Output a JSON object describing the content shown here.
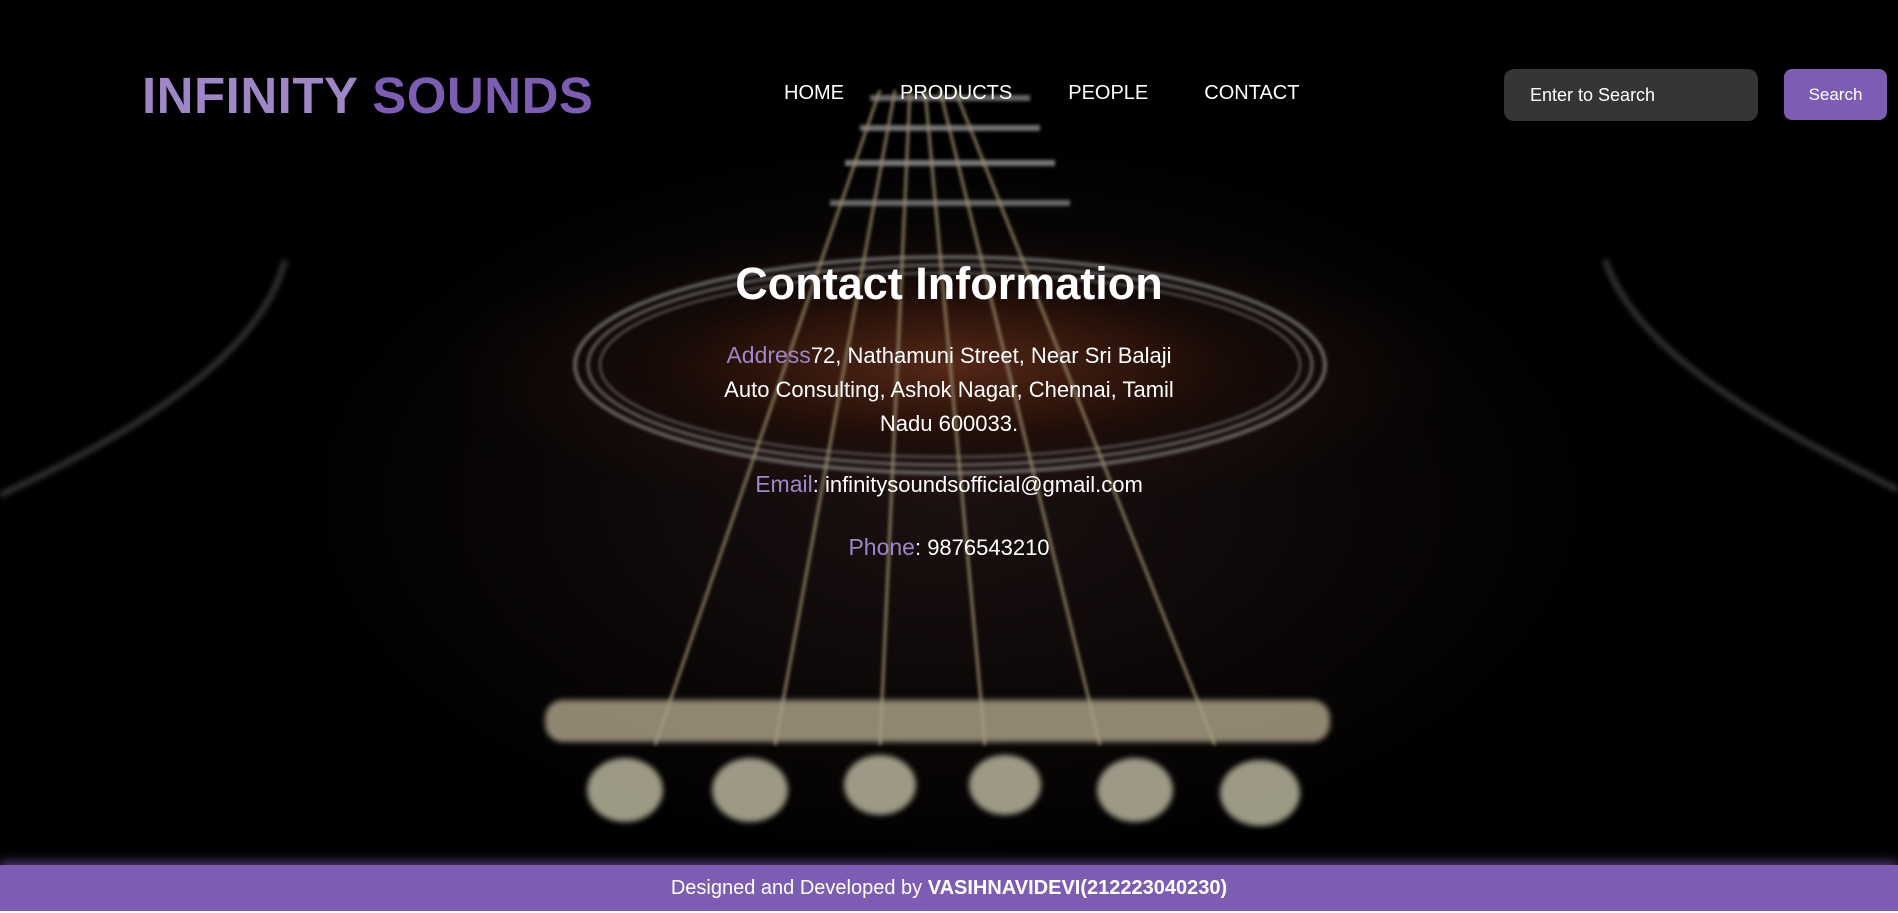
{
  "brand": {
    "word1": "INFINITY",
    "word2": "SOUNDS"
  },
  "nav": {
    "home": "HOME",
    "products": "PRODUCTS",
    "people": "PEOPLE",
    "contact": "CONTACT"
  },
  "search": {
    "placeholder": "Enter to Search",
    "button_label": "Search"
  },
  "contact": {
    "title": "Contact Information",
    "address_label": "Address",
    "address_value": "72, Nathamuni Street, Near Sri Balaji Auto Consulting, Ashok Nagar, Chennai, Tamil Nadu 600033.",
    "email_label": "Email",
    "email_value": ": infinitysoundsofficial@gmail.com",
    "phone_label": "Phone",
    "phone_value": ": 9876543210"
  },
  "footer": {
    "prefix": "Designed and Developed by ",
    "author": "VASIHNAVIDEVI(212223040230)"
  },
  "colors": {
    "accent": "#7d5cb4",
    "accent_light": "#9f86c6",
    "search_bg": "#353535",
    "background": "#000000"
  }
}
